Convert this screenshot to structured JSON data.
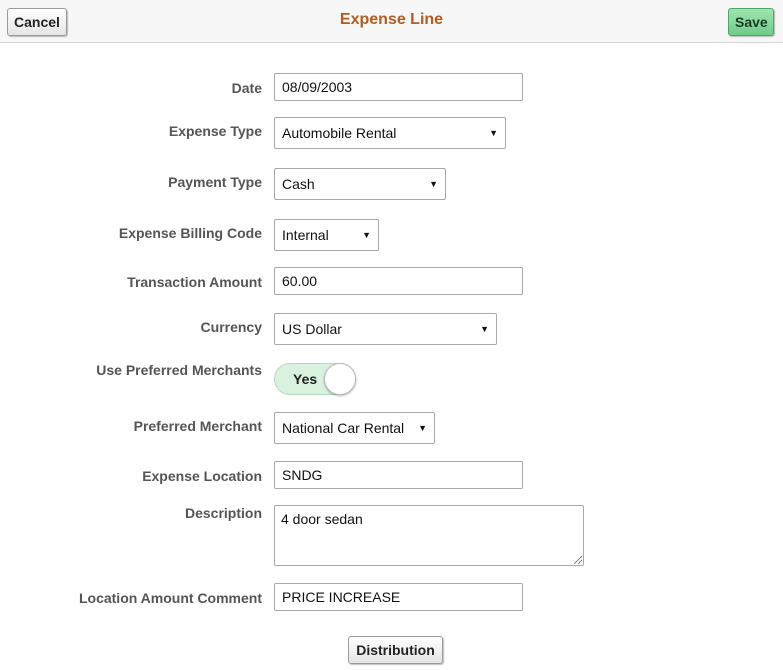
{
  "header": {
    "title": "Expense Line",
    "cancel_label": "Cancel",
    "save_label": "Save"
  },
  "form": {
    "date": {
      "label": "Date",
      "value": "08/09/2003"
    },
    "expense_type": {
      "label": "Expense Type",
      "value": "Automobile Rental"
    },
    "payment_type": {
      "label": "Payment Type",
      "value": "Cash"
    },
    "billing_code": {
      "label": "Expense Billing Code",
      "value": "Internal"
    },
    "transaction_amount": {
      "label": "Transaction Amount",
      "value": "60.00"
    },
    "currency": {
      "label": "Currency",
      "value": "US Dollar"
    },
    "use_preferred_merchants": {
      "label": "Use Preferred Merchants",
      "value": "Yes"
    },
    "preferred_merchant": {
      "label": "Preferred Merchant",
      "value": "National Car Rental"
    },
    "expense_location": {
      "label": "Expense Location",
      "value": "SNDG"
    },
    "description": {
      "label": "Description",
      "value": "4 door sedan"
    },
    "location_amount_comment": {
      "label": "Location Amount Comment",
      "value": "PRICE INCREASE"
    }
  },
  "footer": {
    "distribution_label": "Distribution"
  },
  "colors": {
    "title": "#b35c1e",
    "save_button": "#6fcc8b",
    "toggle_on": "#d9f2e0"
  },
  "icons": {
    "dropdown": "triangle-down"
  }
}
